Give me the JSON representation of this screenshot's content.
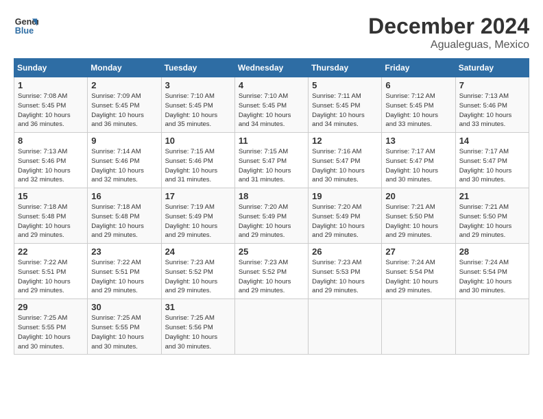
{
  "header": {
    "logo_line1": "General",
    "logo_line2": "Blue",
    "month": "December 2024",
    "location": "Agualeguas, Mexico"
  },
  "weekdays": [
    "Sunday",
    "Monday",
    "Tuesday",
    "Wednesday",
    "Thursday",
    "Friday",
    "Saturday"
  ],
  "weeks": [
    [
      {
        "day": "1",
        "info": "Sunrise: 7:08 AM\nSunset: 5:45 PM\nDaylight: 10 hours\nand 36 minutes."
      },
      {
        "day": "2",
        "info": "Sunrise: 7:09 AM\nSunset: 5:45 PM\nDaylight: 10 hours\nand 36 minutes."
      },
      {
        "day": "3",
        "info": "Sunrise: 7:10 AM\nSunset: 5:45 PM\nDaylight: 10 hours\nand 35 minutes."
      },
      {
        "day": "4",
        "info": "Sunrise: 7:10 AM\nSunset: 5:45 PM\nDaylight: 10 hours\nand 34 minutes."
      },
      {
        "day": "5",
        "info": "Sunrise: 7:11 AM\nSunset: 5:45 PM\nDaylight: 10 hours\nand 34 minutes."
      },
      {
        "day": "6",
        "info": "Sunrise: 7:12 AM\nSunset: 5:45 PM\nDaylight: 10 hours\nand 33 minutes."
      },
      {
        "day": "7",
        "info": "Sunrise: 7:13 AM\nSunset: 5:46 PM\nDaylight: 10 hours\nand 33 minutes."
      }
    ],
    [
      {
        "day": "8",
        "info": "Sunrise: 7:13 AM\nSunset: 5:46 PM\nDaylight: 10 hours\nand 32 minutes."
      },
      {
        "day": "9",
        "info": "Sunrise: 7:14 AM\nSunset: 5:46 PM\nDaylight: 10 hours\nand 32 minutes."
      },
      {
        "day": "10",
        "info": "Sunrise: 7:15 AM\nSunset: 5:46 PM\nDaylight: 10 hours\nand 31 minutes."
      },
      {
        "day": "11",
        "info": "Sunrise: 7:15 AM\nSunset: 5:47 PM\nDaylight: 10 hours\nand 31 minutes."
      },
      {
        "day": "12",
        "info": "Sunrise: 7:16 AM\nSunset: 5:47 PM\nDaylight: 10 hours\nand 30 minutes."
      },
      {
        "day": "13",
        "info": "Sunrise: 7:17 AM\nSunset: 5:47 PM\nDaylight: 10 hours\nand 30 minutes."
      },
      {
        "day": "14",
        "info": "Sunrise: 7:17 AM\nSunset: 5:47 PM\nDaylight: 10 hours\nand 30 minutes."
      }
    ],
    [
      {
        "day": "15",
        "info": "Sunrise: 7:18 AM\nSunset: 5:48 PM\nDaylight: 10 hours\nand 29 minutes."
      },
      {
        "day": "16",
        "info": "Sunrise: 7:18 AM\nSunset: 5:48 PM\nDaylight: 10 hours\nand 29 minutes."
      },
      {
        "day": "17",
        "info": "Sunrise: 7:19 AM\nSunset: 5:49 PM\nDaylight: 10 hours\nand 29 minutes."
      },
      {
        "day": "18",
        "info": "Sunrise: 7:20 AM\nSunset: 5:49 PM\nDaylight: 10 hours\nand 29 minutes."
      },
      {
        "day": "19",
        "info": "Sunrise: 7:20 AM\nSunset: 5:49 PM\nDaylight: 10 hours\nand 29 minutes."
      },
      {
        "day": "20",
        "info": "Sunrise: 7:21 AM\nSunset: 5:50 PM\nDaylight: 10 hours\nand 29 minutes."
      },
      {
        "day": "21",
        "info": "Sunrise: 7:21 AM\nSunset: 5:50 PM\nDaylight: 10 hours\nand 29 minutes."
      }
    ],
    [
      {
        "day": "22",
        "info": "Sunrise: 7:22 AM\nSunset: 5:51 PM\nDaylight: 10 hours\nand 29 minutes."
      },
      {
        "day": "23",
        "info": "Sunrise: 7:22 AM\nSunset: 5:51 PM\nDaylight: 10 hours\nand 29 minutes."
      },
      {
        "day": "24",
        "info": "Sunrise: 7:23 AM\nSunset: 5:52 PM\nDaylight: 10 hours\nand 29 minutes."
      },
      {
        "day": "25",
        "info": "Sunrise: 7:23 AM\nSunset: 5:52 PM\nDaylight: 10 hours\nand 29 minutes."
      },
      {
        "day": "26",
        "info": "Sunrise: 7:23 AM\nSunset: 5:53 PM\nDaylight: 10 hours\nand 29 minutes."
      },
      {
        "day": "27",
        "info": "Sunrise: 7:24 AM\nSunset: 5:54 PM\nDaylight: 10 hours\nand 29 minutes."
      },
      {
        "day": "28",
        "info": "Sunrise: 7:24 AM\nSunset: 5:54 PM\nDaylight: 10 hours\nand 30 minutes."
      }
    ],
    [
      {
        "day": "29",
        "info": "Sunrise: 7:25 AM\nSunset: 5:55 PM\nDaylight: 10 hours\nand 30 minutes."
      },
      {
        "day": "30",
        "info": "Sunrise: 7:25 AM\nSunset: 5:55 PM\nDaylight: 10 hours\nand 30 minutes."
      },
      {
        "day": "31",
        "info": "Sunrise: 7:25 AM\nSunset: 5:56 PM\nDaylight: 10 hours\nand 30 minutes."
      },
      {
        "day": "",
        "info": ""
      },
      {
        "day": "",
        "info": ""
      },
      {
        "day": "",
        "info": ""
      },
      {
        "day": "",
        "info": ""
      }
    ]
  ]
}
